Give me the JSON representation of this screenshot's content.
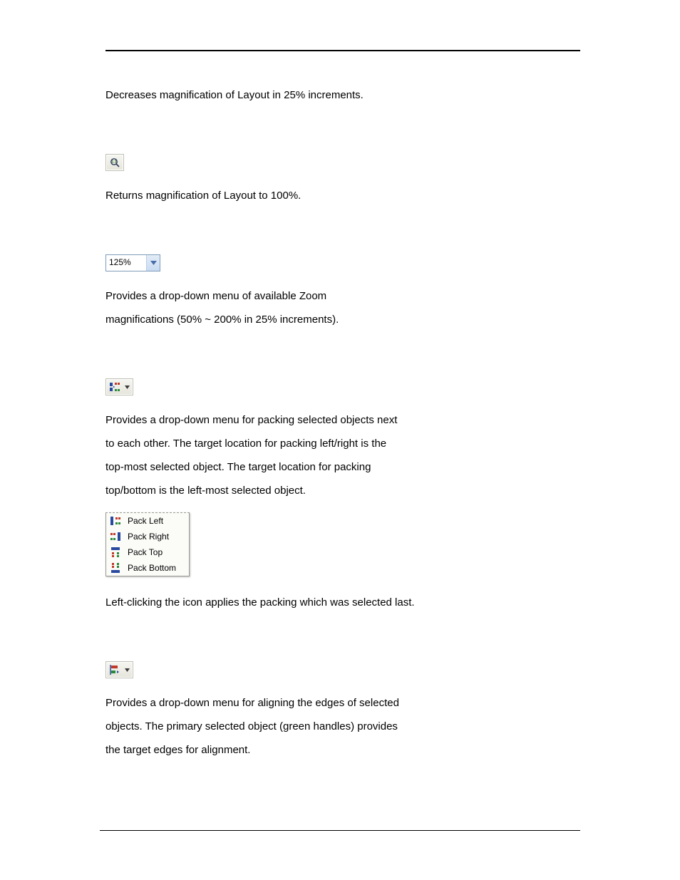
{
  "sections": {
    "zoom_out_desc": "Decreases magnification of Layout in 25% increments.",
    "zoom_100_desc": "Returns magnification of Layout to 100%.",
    "zoom_select": {
      "value": "125%",
      "desc_l1": "Provides a drop-down menu of available Zoom",
      "desc_l2": "magnifications (50% ~ 200% in 25% increments)."
    },
    "pack": {
      "desc_l1": "Provides a drop-down menu for packing selected objects next",
      "desc_l2": "to each other. The target location for packing left/right is the",
      "desc_l3": "top-most selected object. The target location for packing",
      "desc_l4": "top/bottom is the left-most selected object.",
      "menu": [
        "Pack Left",
        "Pack Right",
        "Pack Top",
        "Pack Bottom"
      ],
      "note": "Left-clicking the icon applies the packing which was selected last."
    },
    "align": {
      "desc_l1": "Provides a drop-down menu for aligning the edges of selected",
      "desc_l2": "objects. The primary selected object (green handles) provides",
      "desc_l3": "the target edges for alignment."
    }
  }
}
